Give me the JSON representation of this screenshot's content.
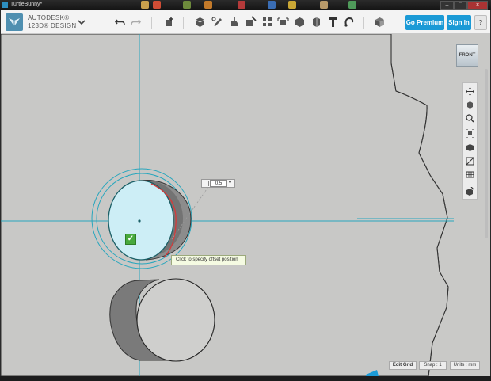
{
  "window": {
    "title": "TurtleBunny*"
  },
  "app": {
    "brand_line1": "AUTODESK®",
    "brand_line2": "123D® DESIGN"
  },
  "toolbar": {
    "tools": [
      "undo-icon",
      "redo-icon",
      "import-icon",
      "primitives-icon",
      "sketch-icon",
      "construct-icon",
      "modify-icon",
      "pattern-icon",
      "group-icon",
      "combine-icon",
      "measure-icon",
      "text-icon",
      "snap-icon",
      "material-icon"
    ]
  },
  "buttons": {
    "premium": "Go Premium",
    "sign_in": "Sign In",
    "help": "?"
  },
  "viewcube": {
    "label": "FRONT"
  },
  "navbar": {
    "tools": [
      "pan-icon",
      "orbit-icon",
      "zoom-icon",
      "fit-icon",
      "view-icon",
      "visibility-icon",
      "grid-icon",
      "material-view-icon"
    ]
  },
  "offset_input": {
    "value": "0.5"
  },
  "tooltip": {
    "text": "Click to specify offset position"
  },
  "status": {
    "edit_grid": "Edit Grid",
    "snap": "Snap : 1",
    "units": "Units : mm"
  },
  "colors": {
    "accent": "#1b9ad6",
    "axis": "#27a6bd",
    "highlight": "#cdeef6"
  }
}
